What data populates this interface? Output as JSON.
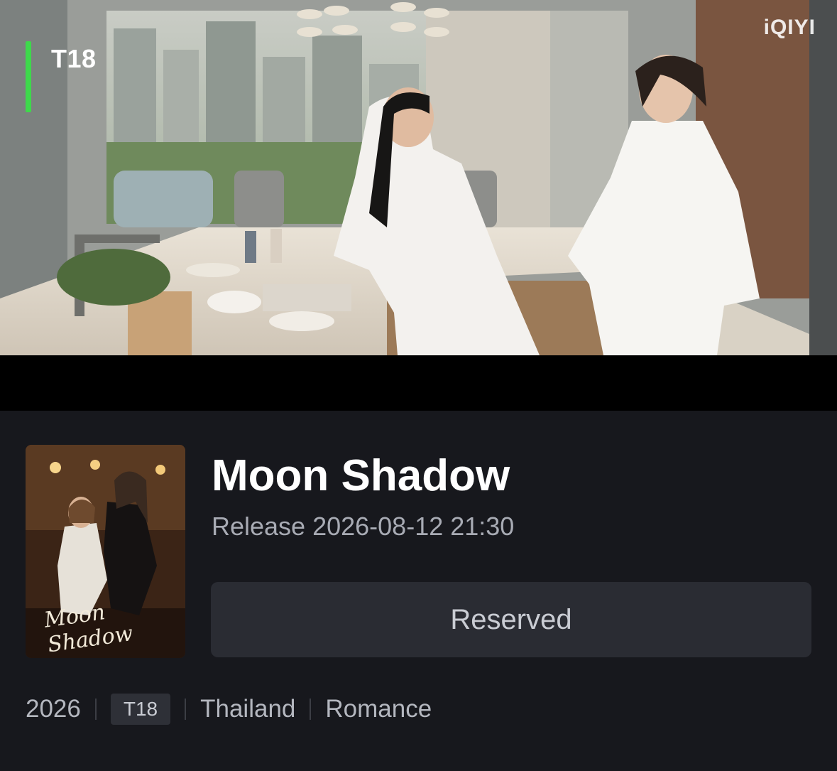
{
  "video": {
    "rating_overlay": "T18",
    "watermark": "iQIYI",
    "rating_bar_color": "#3ed94b"
  },
  "show": {
    "title": "Moon Shadow",
    "release": "Release 2026-08-12 21:30",
    "reserve_label": "Reserved",
    "poster_title": "Moon Shadow",
    "meta": {
      "year": "2026",
      "rating": "T18",
      "country": "Thailand",
      "genre": "Romance"
    }
  }
}
